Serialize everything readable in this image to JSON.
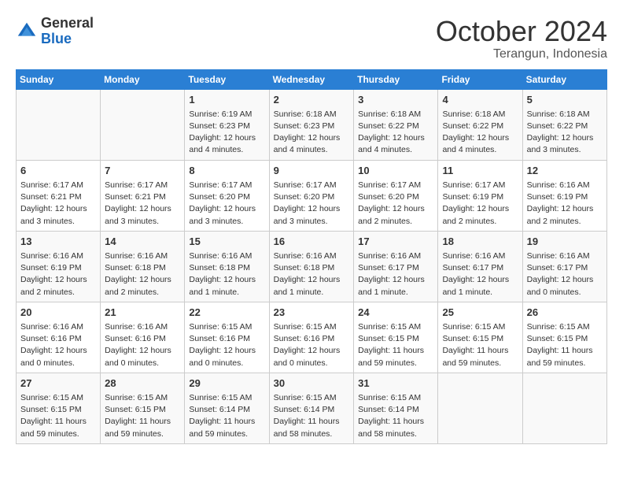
{
  "logo": {
    "general": "General",
    "blue": "Blue"
  },
  "header": {
    "month": "October 2024",
    "location": "Terangun, Indonesia"
  },
  "weekdays": [
    "Sunday",
    "Monday",
    "Tuesday",
    "Wednesday",
    "Thursday",
    "Friday",
    "Saturday"
  ],
  "weeks": [
    [
      {
        "day": "",
        "detail": ""
      },
      {
        "day": "",
        "detail": ""
      },
      {
        "day": "1",
        "detail": "Sunrise: 6:19 AM\nSunset: 6:23 PM\nDaylight: 12 hours and 4 minutes."
      },
      {
        "day": "2",
        "detail": "Sunrise: 6:18 AM\nSunset: 6:23 PM\nDaylight: 12 hours and 4 minutes."
      },
      {
        "day": "3",
        "detail": "Sunrise: 6:18 AM\nSunset: 6:22 PM\nDaylight: 12 hours and 4 minutes."
      },
      {
        "day": "4",
        "detail": "Sunrise: 6:18 AM\nSunset: 6:22 PM\nDaylight: 12 hours and 4 minutes."
      },
      {
        "day": "5",
        "detail": "Sunrise: 6:18 AM\nSunset: 6:22 PM\nDaylight: 12 hours and 3 minutes."
      }
    ],
    [
      {
        "day": "6",
        "detail": "Sunrise: 6:17 AM\nSunset: 6:21 PM\nDaylight: 12 hours and 3 minutes."
      },
      {
        "day": "7",
        "detail": "Sunrise: 6:17 AM\nSunset: 6:21 PM\nDaylight: 12 hours and 3 minutes."
      },
      {
        "day": "8",
        "detail": "Sunrise: 6:17 AM\nSunset: 6:20 PM\nDaylight: 12 hours and 3 minutes."
      },
      {
        "day": "9",
        "detail": "Sunrise: 6:17 AM\nSunset: 6:20 PM\nDaylight: 12 hours and 3 minutes."
      },
      {
        "day": "10",
        "detail": "Sunrise: 6:17 AM\nSunset: 6:20 PM\nDaylight: 12 hours and 2 minutes."
      },
      {
        "day": "11",
        "detail": "Sunrise: 6:17 AM\nSunset: 6:19 PM\nDaylight: 12 hours and 2 minutes."
      },
      {
        "day": "12",
        "detail": "Sunrise: 6:16 AM\nSunset: 6:19 PM\nDaylight: 12 hours and 2 minutes."
      }
    ],
    [
      {
        "day": "13",
        "detail": "Sunrise: 6:16 AM\nSunset: 6:19 PM\nDaylight: 12 hours and 2 minutes."
      },
      {
        "day": "14",
        "detail": "Sunrise: 6:16 AM\nSunset: 6:18 PM\nDaylight: 12 hours and 2 minutes."
      },
      {
        "day": "15",
        "detail": "Sunrise: 6:16 AM\nSunset: 6:18 PM\nDaylight: 12 hours and 1 minute."
      },
      {
        "day": "16",
        "detail": "Sunrise: 6:16 AM\nSunset: 6:18 PM\nDaylight: 12 hours and 1 minute."
      },
      {
        "day": "17",
        "detail": "Sunrise: 6:16 AM\nSunset: 6:17 PM\nDaylight: 12 hours and 1 minute."
      },
      {
        "day": "18",
        "detail": "Sunrise: 6:16 AM\nSunset: 6:17 PM\nDaylight: 12 hours and 1 minute."
      },
      {
        "day": "19",
        "detail": "Sunrise: 6:16 AM\nSunset: 6:17 PM\nDaylight: 12 hours and 0 minutes."
      }
    ],
    [
      {
        "day": "20",
        "detail": "Sunrise: 6:16 AM\nSunset: 6:16 PM\nDaylight: 12 hours and 0 minutes."
      },
      {
        "day": "21",
        "detail": "Sunrise: 6:16 AM\nSunset: 6:16 PM\nDaylight: 12 hours and 0 minutes."
      },
      {
        "day": "22",
        "detail": "Sunrise: 6:15 AM\nSunset: 6:16 PM\nDaylight: 12 hours and 0 minutes."
      },
      {
        "day": "23",
        "detail": "Sunrise: 6:15 AM\nSunset: 6:16 PM\nDaylight: 12 hours and 0 minutes."
      },
      {
        "day": "24",
        "detail": "Sunrise: 6:15 AM\nSunset: 6:15 PM\nDaylight: 11 hours and 59 minutes."
      },
      {
        "day": "25",
        "detail": "Sunrise: 6:15 AM\nSunset: 6:15 PM\nDaylight: 11 hours and 59 minutes."
      },
      {
        "day": "26",
        "detail": "Sunrise: 6:15 AM\nSunset: 6:15 PM\nDaylight: 11 hours and 59 minutes."
      }
    ],
    [
      {
        "day": "27",
        "detail": "Sunrise: 6:15 AM\nSunset: 6:15 PM\nDaylight: 11 hours and 59 minutes."
      },
      {
        "day": "28",
        "detail": "Sunrise: 6:15 AM\nSunset: 6:15 PM\nDaylight: 11 hours and 59 minutes."
      },
      {
        "day": "29",
        "detail": "Sunrise: 6:15 AM\nSunset: 6:14 PM\nDaylight: 11 hours and 59 minutes."
      },
      {
        "day": "30",
        "detail": "Sunrise: 6:15 AM\nSunset: 6:14 PM\nDaylight: 11 hours and 58 minutes."
      },
      {
        "day": "31",
        "detail": "Sunrise: 6:15 AM\nSunset: 6:14 PM\nDaylight: 11 hours and 58 minutes."
      },
      {
        "day": "",
        "detail": ""
      },
      {
        "day": "",
        "detail": ""
      }
    ]
  ]
}
